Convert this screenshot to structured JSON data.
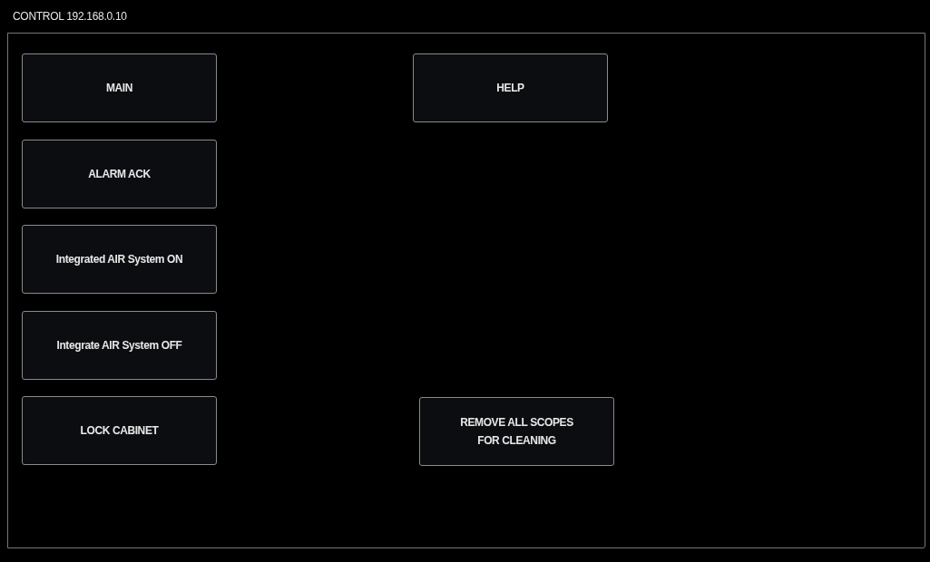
{
  "window": {
    "title": "CONTROL 192.168.0.10"
  },
  "left_buttons": [
    {
      "label": "MAIN"
    },
    {
      "label": "ALARM ACK"
    },
    {
      "label": "Integrated AIR System ON"
    },
    {
      "label": "Integrate AIR System OFF"
    },
    {
      "label": "LOCK CABINET"
    }
  ],
  "right_buttons": [
    {
      "label": "HELP"
    },
    {
      "label": "REMOVE ALL SCOPES\nFOR CLEANING"
    }
  ]
}
